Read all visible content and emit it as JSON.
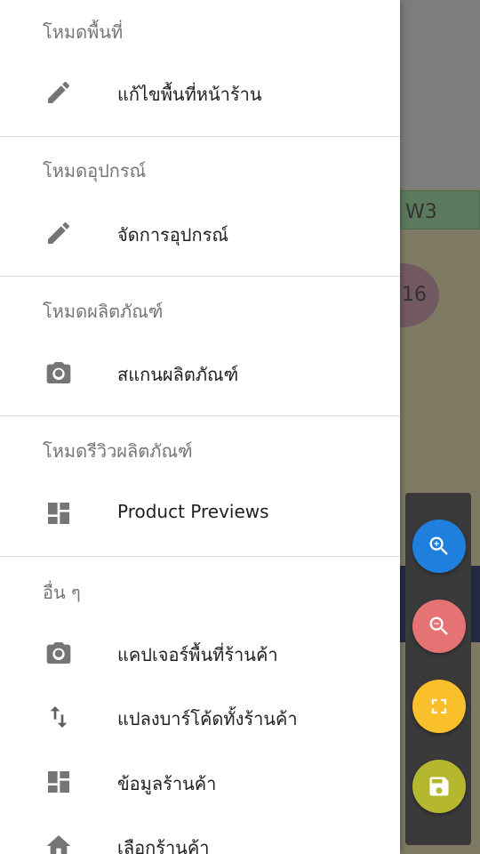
{
  "background": {
    "shelf_label": "W3",
    "circle_label": "16"
  },
  "drawer": {
    "sections": [
      {
        "title": "โหมดพื้นที่",
        "items": [
          {
            "label": "แก้ไขพื้นที่หน้าร้าน",
            "icon": "pencil-icon"
          }
        ]
      },
      {
        "title": "โหมดอุปกรณ์",
        "items": [
          {
            "label": "จัดการอุปกรณ์",
            "icon": "pencil-icon"
          }
        ]
      },
      {
        "title": "โหมดผลิตภัณฑ์",
        "items": [
          {
            "label": "สแกนผลิตภัณฑ์",
            "icon": "camera-icon"
          }
        ]
      },
      {
        "title": "โหมดรีวิวผลิตภัณฑ์",
        "items": [
          {
            "label": "Product Previews",
            "icon": "dashboard-icon"
          }
        ]
      },
      {
        "title": "อื่น ๆ",
        "items": [
          {
            "label": "แคปเจอร์พื้นที่ร้านค้า",
            "icon": "camera-icon"
          },
          {
            "label": "แปลงบาร์โค้ดทั้งร้านค้า",
            "icon": "swap-vertical-icon"
          },
          {
            "label": "ข้อมูลร้านค้า",
            "icon": "dashboard-icon"
          },
          {
            "label": "เลือกร้านค้า",
            "icon": "home-icon"
          }
        ]
      }
    ]
  },
  "fabs": [
    {
      "name": "zoom-in",
      "icon": "zoom-in-icon",
      "color": "#1e7fdc"
    },
    {
      "name": "zoom-out",
      "icon": "zoom-out-icon",
      "color": "#e57373"
    },
    {
      "name": "fit-screen",
      "icon": "fullscreen-icon",
      "color": "#f9c02c"
    },
    {
      "name": "save",
      "icon": "save-icon",
      "color": "#b5b82e"
    }
  ]
}
